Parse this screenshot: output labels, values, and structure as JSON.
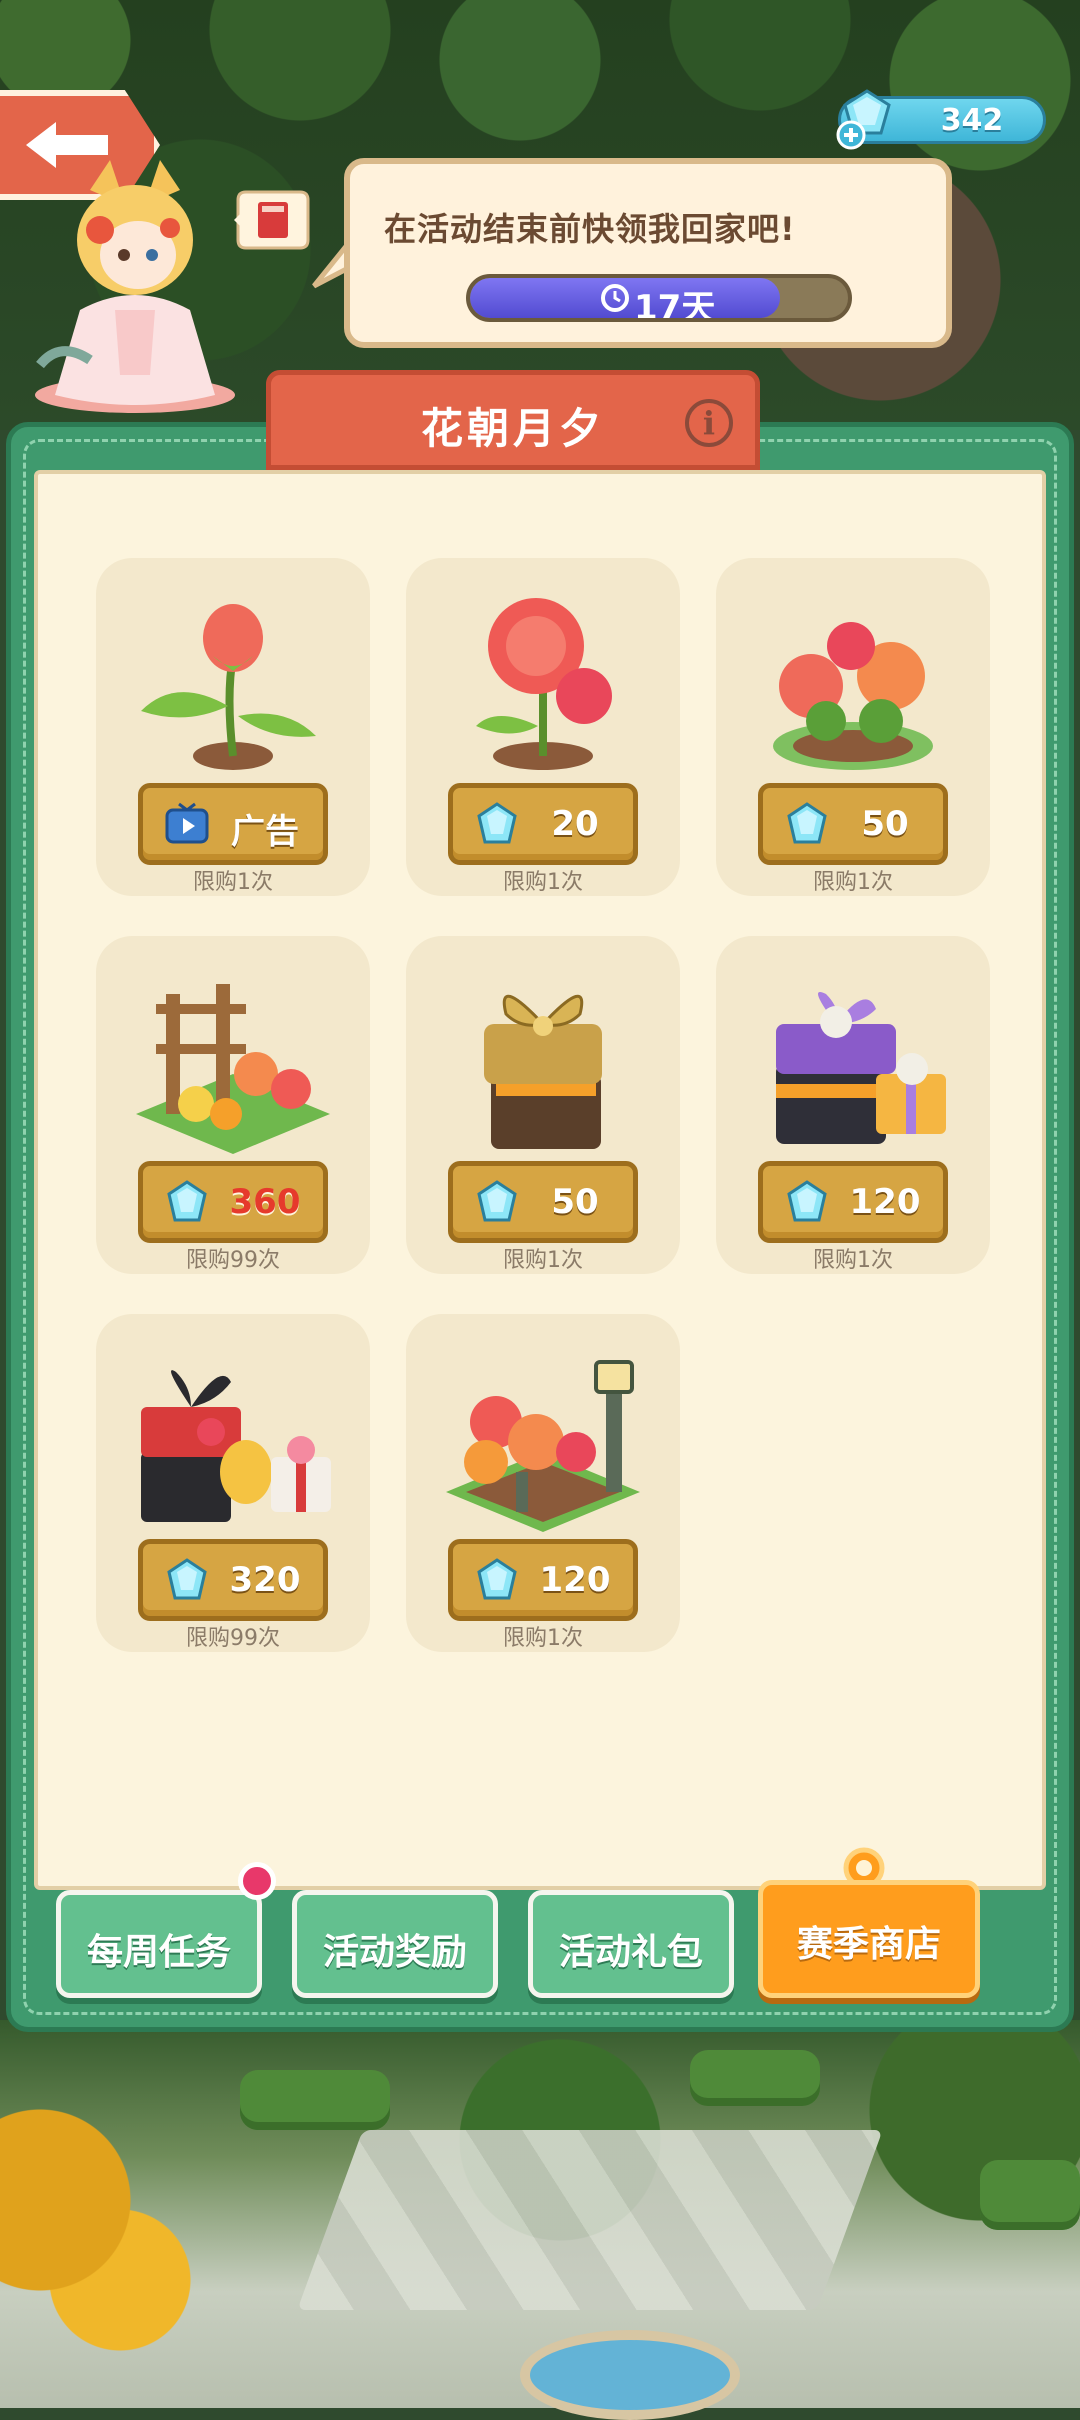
{
  "header": {
    "gem_count": "342",
    "speech_text": "在活动结束前快领我回家吧!",
    "timer_text": "17天",
    "timer_progress": 0.82
  },
  "panel": {
    "title": "花朝月夕",
    "info_label": "i"
  },
  "shop_items": [
    {
      "item": "peony-sprout",
      "price": "广告",
      "currency": "ad",
      "limit": "限购1次"
    },
    {
      "item": "peony-bloom",
      "price": "20",
      "currency": "gem",
      "limit": "限购1次"
    },
    {
      "item": "peony-bush",
      "price": "50",
      "currency": "gem",
      "limit": "限购1次"
    },
    {
      "item": "flower-arch",
      "price": "360",
      "currency": "gem",
      "limit": "限购99次",
      "price_color": "#e63a2c"
    },
    {
      "item": "gold-gift-box",
      "price": "50",
      "currency": "gem",
      "limit": "限购1次"
    },
    {
      "item": "purple-gift-boxes",
      "price": "120",
      "currency": "gem",
      "limit": "限购1次"
    },
    {
      "item": "black-red-gift-boxes",
      "price": "320",
      "currency": "gem",
      "limit": "限购99次"
    },
    {
      "item": "flower-lantern-garden",
      "price": "120",
      "currency": "gem",
      "limit": "限购1次"
    }
  ],
  "tabs": [
    {
      "label": "每周任务",
      "active": false,
      "notification": true
    },
    {
      "label": "活动奖励",
      "active": false
    },
    {
      "label": "活动礼包",
      "active": false
    },
    {
      "label": "赛季商店",
      "active": true
    }
  ],
  "colors": {
    "panel_green": "#3f9a6e",
    "title_tab": "#e3654a",
    "active_tab": "#ff9d1d",
    "price_button": "#d6a543"
  }
}
